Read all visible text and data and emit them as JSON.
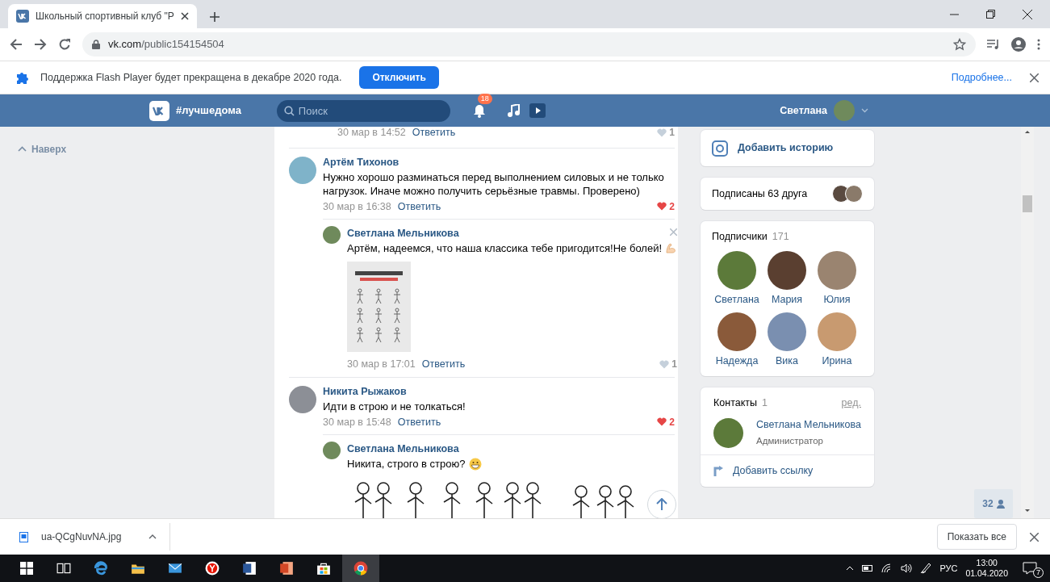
{
  "browser": {
    "tab": {
      "title": "Школьный спортивный клуб \"Р",
      "selected": true
    },
    "url": "vk.com/public154154504"
  },
  "infobar": {
    "message": "Поддержка Flash Player будет прекращена в декабре 2020 года.",
    "button": "Отключить",
    "link": "Подробнее..."
  },
  "vk_header": {
    "hashtag": "#лучшедома",
    "search": {
      "placeholder": "Поиск"
    },
    "notifications_badge": "18",
    "user_name": "Светлана"
  },
  "left_nav": {
    "back_to_top": "Наверх"
  },
  "previous_comment_footer": {
    "date": "30 мар в 14:52",
    "reply": "Ответить",
    "likes": "1",
    "liked": false
  },
  "comments": [
    {
      "author": "Артём Тихонов",
      "text": "Нужно хорошо разминаться перед выполнением силовых и не только нагрузок. Иначе можно получить серьёзные травмы. Проверено)",
      "date": "30 мар в 16:38",
      "reply": "Ответить",
      "likes": "2",
      "liked": true,
      "replies": [
        {
          "author": "Светлана Мельникова",
          "text": "Артём, надеемся, что наша классика тебе пригодится!Не болей!",
          "emoji": {
            "kind": "biceps"
          },
          "attachment": {
            "kind": "poster"
          },
          "date": "30 мар в 17:01",
          "reply": "Ответить",
          "likes": "1",
          "liked": false,
          "removable": true
        }
      ]
    },
    {
      "author": "Никита Рыжаков",
      "text": "Идти в строю и не толкаться!",
      "date": "30 мар в 15:48",
      "reply": "Ответить",
      "likes": "2",
      "liked": true,
      "replies": [
        {
          "author": "Светлана Мельникова",
          "text": "Никита, строго в строю?",
          "emoji": {
            "kind": "grin"
          },
          "attachment": {
            "kind": "drawing"
          }
        }
      ]
    }
  ],
  "sidebar": {
    "add_story": "Добавить историю",
    "friends": "Подписаны 63 друга",
    "followers": {
      "title": "Подписчики",
      "count": "171",
      "members": [
        "Светлана",
        "Мария",
        "Юлия",
        "Надежда",
        "Вика",
        "Ирина"
      ]
    },
    "contacts": {
      "title": "Контакты",
      "count": "1",
      "edit": "ред.",
      "people": [
        {
          "name": "Светлана Мельникова",
          "role": "Администратор"
        }
      ]
    },
    "add_link": "Добавить ссылку"
  },
  "online_badge": "32",
  "downloads": {
    "file": "ua-QCgNuvNA.jpg",
    "show_all": "Показать все"
  },
  "taskbar": {
    "apps": [
      {
        "kind": "task_view",
        "active": false
      },
      {
        "kind": "edge",
        "active": false
      },
      {
        "kind": "explorer",
        "active": false
      },
      {
        "kind": "mail",
        "active": false
      },
      {
        "kind": "yandex",
        "active": false
      },
      {
        "kind": "word",
        "active": false
      },
      {
        "kind": "powerpoint",
        "active": false
      },
      {
        "kind": "store",
        "active": false
      },
      {
        "kind": "chrome",
        "active": true
      }
    ],
    "language": "РУС",
    "time": "13:00",
    "date": "01.04.2020",
    "notifications": "7"
  }
}
